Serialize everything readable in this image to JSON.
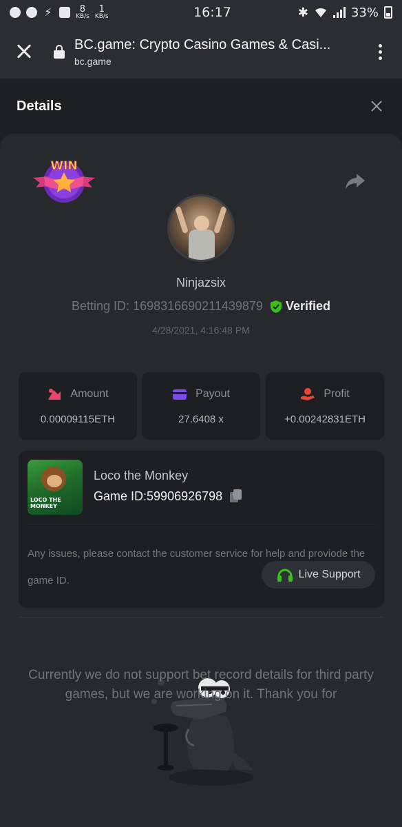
{
  "status_bar": {
    "time": "16:17",
    "battery": "33%",
    "speed_down": "8",
    "speed_up": "1",
    "speed_unit": "KB/s",
    "icons": [
      "messenger-icon",
      "facebook-icon",
      "bolt-icon",
      "vpn-icon",
      "bluetooth-icon",
      "wifi-icon",
      "signal-icon",
      "battery-icon"
    ]
  },
  "browser": {
    "title": "BC.game: Crypto Casino Games & Casi...",
    "url": "bc.game"
  },
  "details": {
    "title": "Details"
  },
  "bet": {
    "badge_text": "WIN",
    "username": "Ninjazsix",
    "betting_id_label": "Betting ID:",
    "betting_id": "1698316690211439879",
    "verified_label": "Verified",
    "timestamp": "4/28/2021, 4:16:48 PM"
  },
  "stats": {
    "amount_label": "Amount",
    "amount_value": "0.00009115ETH",
    "payout_label": "Payout",
    "payout_value": "27.6408 x",
    "profit_label": "Profit",
    "profit_value": "+0.00242831ETH"
  },
  "game": {
    "name": "Loco the Monkey",
    "id_label": "Game ID:",
    "id_value": "59906926798",
    "thumb_label_top": "LOCO THE",
    "thumb_label_bottom": "MONKEY",
    "issue_text": "Any issues, please contact the customer service for help and proviode the game ID.",
    "support_label": "Live Support"
  },
  "footer": {
    "text": "Currently we do not support bet record details for third party games, but we are working on it. Thank you for"
  },
  "colors": {
    "background": "#1e1f21",
    "card": "#27292c",
    "accent_green": "#3bc117",
    "amount_icon": "#e8466a",
    "payout_icon": "#7b4cf0",
    "profit_icon": "#e8463a"
  }
}
